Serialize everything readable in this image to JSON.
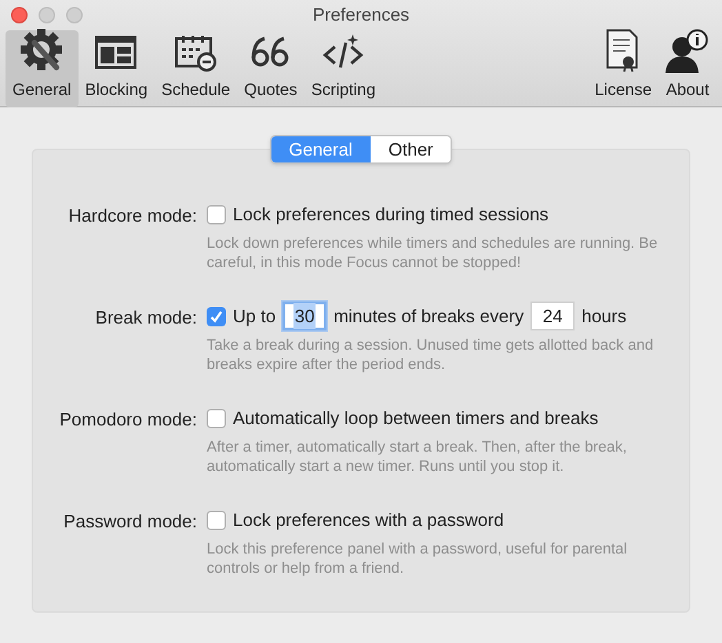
{
  "window": {
    "title": "Preferences"
  },
  "toolbar": {
    "left": [
      {
        "label": "General",
        "selected": true
      },
      {
        "label": "Blocking",
        "selected": false
      },
      {
        "label": "Schedule",
        "selected": false
      },
      {
        "label": "Quotes",
        "selected": false
      },
      {
        "label": "Scripting",
        "selected": false
      }
    ],
    "right": [
      {
        "label": "License",
        "selected": false
      },
      {
        "label": "About",
        "selected": false
      }
    ]
  },
  "segments": [
    {
      "label": "General",
      "selected": true
    },
    {
      "label": "Other",
      "selected": false
    }
  ],
  "settings": [
    {
      "label": "Hardcore mode:",
      "checked": false,
      "parts": [
        {
          "kind": "text",
          "text": "Lock preferences during timed sessions"
        }
      ],
      "description": "Lock down preferences while timers and schedules are running. Be careful, in this mode Focus cannot be stopped!"
    },
    {
      "label": "Break mode:",
      "checked": true,
      "parts": [
        {
          "kind": "text",
          "text": "Up to"
        },
        {
          "kind": "field",
          "value": "30",
          "selected": true
        },
        {
          "kind": "text",
          "text": "minutes of breaks every"
        },
        {
          "kind": "field",
          "value": "24",
          "selected": false
        },
        {
          "kind": "text",
          "text": "hours"
        }
      ],
      "description": "Take a break during a session. Unused time gets allotted back and breaks expire after the period ends."
    },
    {
      "label": "Pomodoro mode:",
      "checked": false,
      "parts": [
        {
          "kind": "text",
          "text": "Automatically loop between timers and breaks"
        }
      ],
      "description": "After a timer, automatically start a break. Then, after the break, automatically start a new timer. Runs until you stop it."
    },
    {
      "label": "Password mode:",
      "checked": false,
      "parts": [
        {
          "kind": "text",
          "text": "Lock preferences with a password"
        }
      ],
      "description": "Lock this preference panel with a password, useful for parental controls or help from a friend."
    }
  ]
}
